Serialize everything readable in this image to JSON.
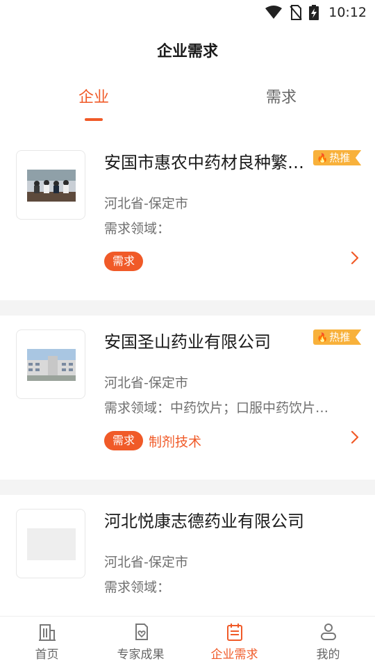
{
  "status_bar": {
    "time": "10:12"
  },
  "header": {
    "title": "企业需求"
  },
  "tabs": [
    {
      "label": "企业",
      "active": true
    },
    {
      "label": "需求",
      "active": false
    }
  ],
  "cards": [
    {
      "title": "安国市惠农中药材良种繁…",
      "hot_label": "热推",
      "region": "河北省-保定市",
      "field": "需求领域：",
      "tag": "需求",
      "tag_text": ""
    },
    {
      "title": "安国圣山药业有限公司",
      "hot_label": "热推",
      "region": "河北省-保定市",
      "field": "需求领域：中药饮片；口服中药饮片…",
      "tag": "需求",
      "tag_text": "制剂技术"
    },
    {
      "title": "河北悦康志德药业有限公司",
      "region": "河北省-保定市",
      "field": "需求领域："
    }
  ],
  "bottom_nav": [
    {
      "label": "首页",
      "icon": "building-icon",
      "active": false
    },
    {
      "label": "专家成果",
      "icon": "document-heart-icon",
      "active": false
    },
    {
      "label": "企业需求",
      "icon": "calendar-list-icon",
      "active": true
    },
    {
      "label": "我的",
      "icon": "person-icon",
      "active": false
    }
  ],
  "colors": {
    "accent": "#f05a28",
    "hot_badge": "#f8b13b",
    "separator": "#f4f4f4"
  }
}
